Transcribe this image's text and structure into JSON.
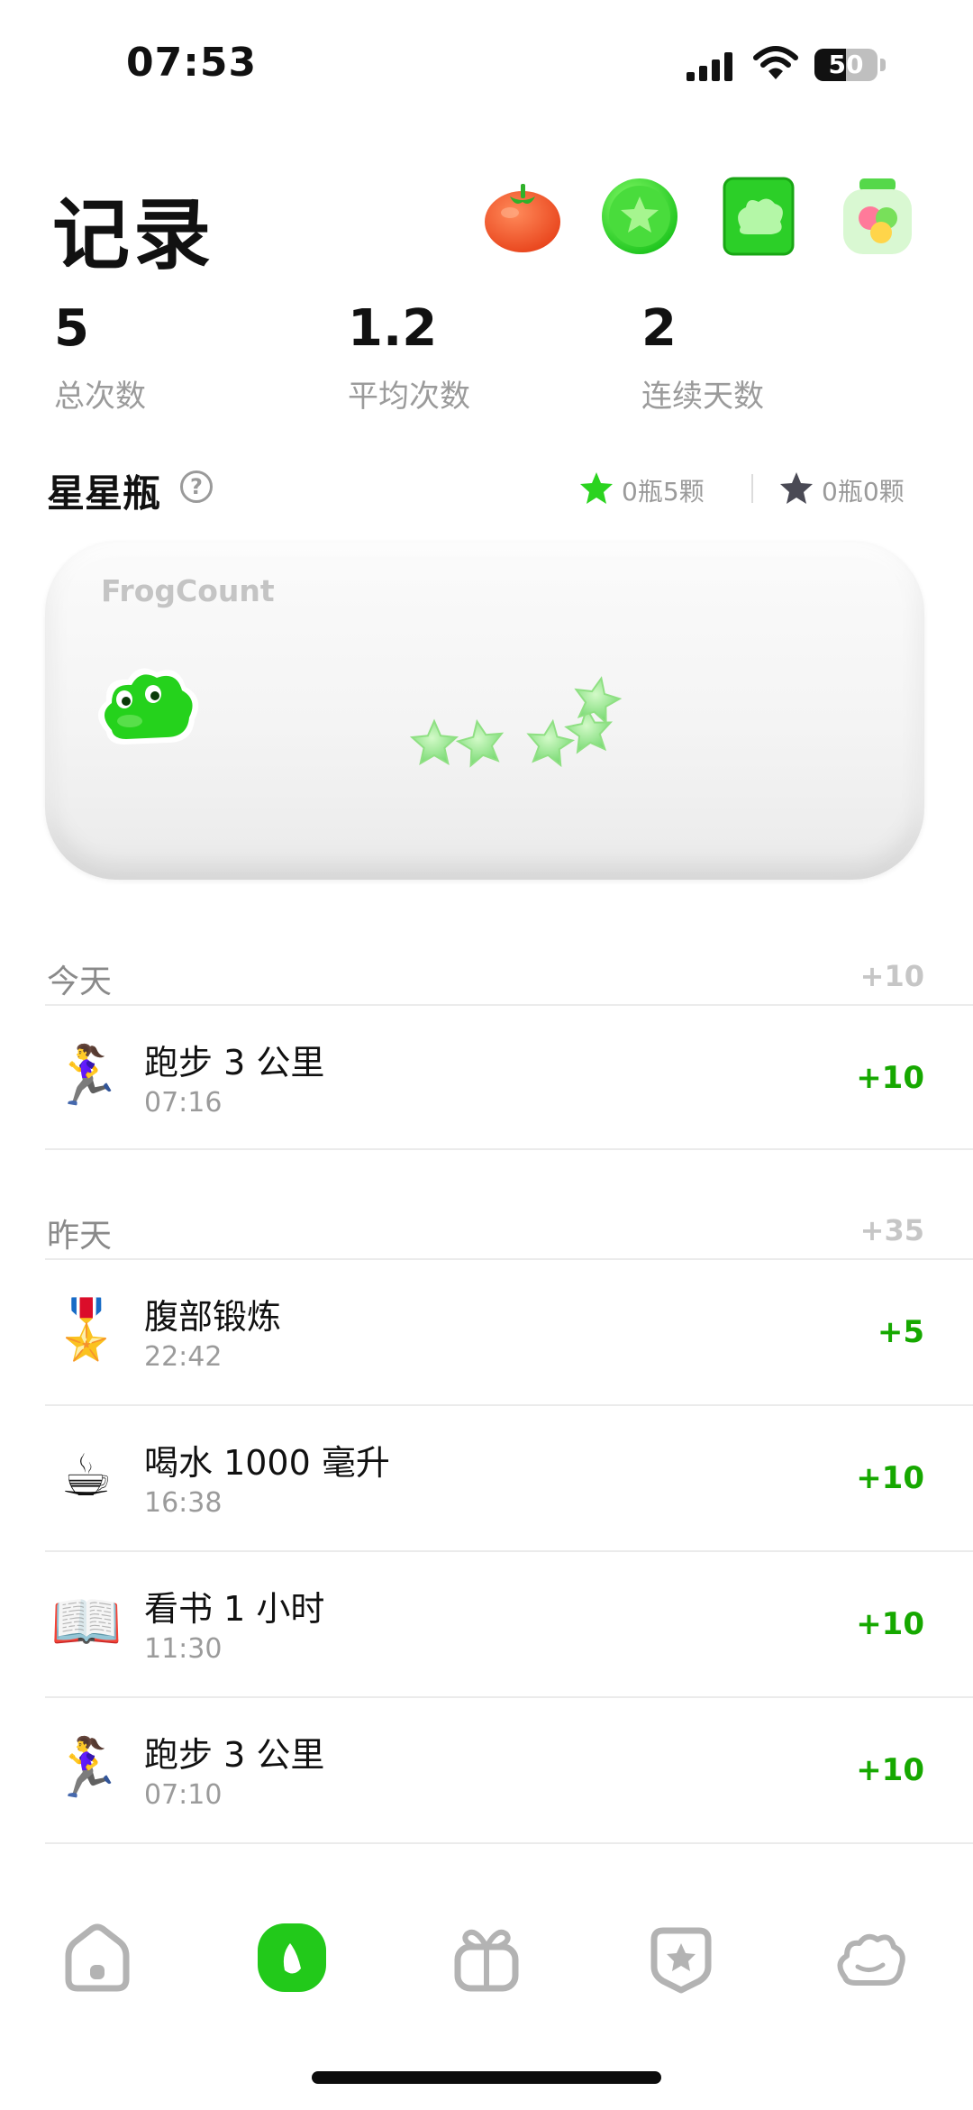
{
  "status_bar": {
    "time": "07:53",
    "battery": "50",
    "battery_level": 0.5
  },
  "header": {
    "title": "记录",
    "icons": [
      "tomato-icon",
      "star-ball-icon",
      "frog-card-icon",
      "candy-jar-icon"
    ]
  },
  "stats": [
    {
      "value": "5",
      "label": "总次数"
    },
    {
      "value": "1.2",
      "label": "平均次数"
    },
    {
      "value": "2",
      "label": "连续天数"
    }
  ],
  "star_bottle": {
    "title": "星星瓶",
    "help": "?",
    "green_count": "0瓶5颗",
    "dark_count": "0瓶0颗",
    "brand": "FrogCount",
    "stars_in_bottle": 5
  },
  "groups": [
    {
      "title": "今天",
      "total": "+10",
      "rows": [
        {
          "emoji": "🏃‍♀️",
          "icon": "runner-icon",
          "name": "跑步 3 公里",
          "time": "07:16",
          "points": "+10"
        }
      ]
    },
    {
      "title": "昨天",
      "total": "+35",
      "rows": [
        {
          "emoji": "🎖️",
          "icon": "medal-icon",
          "name": "腹部锻炼",
          "time": "22:42",
          "points": "+5"
        },
        {
          "emoji": "☕",
          "icon": "coffee-icon",
          "name": "喝水 1000 毫升",
          "time": "16:38",
          "points": "+10"
        },
        {
          "emoji": "📖",
          "icon": "book-icon",
          "name": "看书 1 小时",
          "time": "11:30",
          "points": "+10"
        },
        {
          "emoji": "🏃‍♀️",
          "icon": "runner-icon",
          "name": "跑步 3 公里",
          "time": "07:10",
          "points": "+10"
        }
      ]
    }
  ],
  "tab_bar": {
    "items": [
      "home-icon",
      "leaf-icon",
      "gift-icon",
      "star-badge-icon",
      "frog-icon"
    ],
    "active": "leaf-icon"
  },
  "colors": {
    "accent": "#16a800",
    "active_tab": "#22c91a",
    "muted": "#9b9b9b"
  }
}
